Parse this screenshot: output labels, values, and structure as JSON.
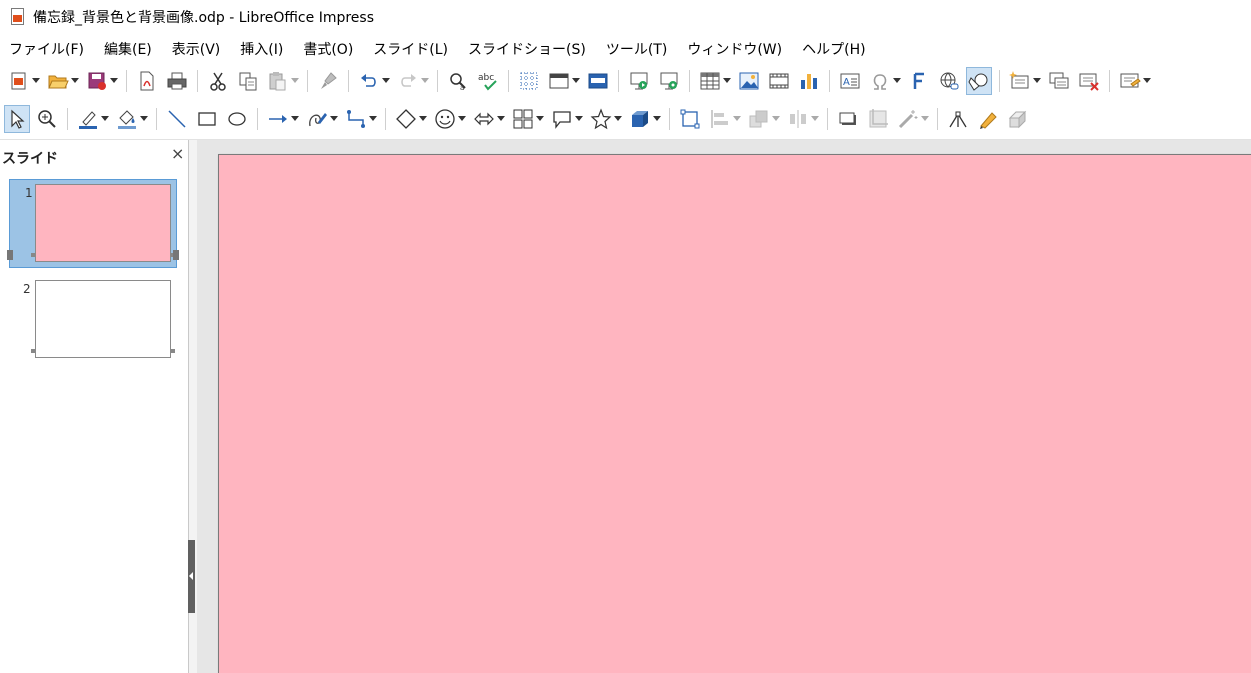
{
  "window": {
    "title": "備忘録_背景色と背景画像.odp - LibreOffice Impress"
  },
  "menu": {
    "items": [
      {
        "label": "ファイル(F)"
      },
      {
        "label": "編集(E)"
      },
      {
        "label": "表示(V)"
      },
      {
        "label": "挿入(I)"
      },
      {
        "label": "書式(O)"
      },
      {
        "label": "スライド(L)"
      },
      {
        "label": "スライドショー(S)"
      },
      {
        "label": "ツール(T)"
      },
      {
        "label": "ウィンドウ(W)"
      },
      {
        "label": "ヘルプ(H)"
      }
    ]
  },
  "toolbar_standard": {
    "spellcheck_label": "abc"
  },
  "slide_pane": {
    "title": "スライド",
    "close_glyph": "×",
    "slides": [
      {
        "number": "1",
        "background": "#ffb5c0",
        "selected": true
      },
      {
        "number": "2",
        "background": "#ffffff",
        "selected": false
      }
    ]
  },
  "main_slide": {
    "background": "#ffb5c0"
  },
  "colors": {
    "accent_blue": "#2a63b0",
    "slide_pink": "#ffb5c0",
    "selection": "#9cc3e5"
  }
}
